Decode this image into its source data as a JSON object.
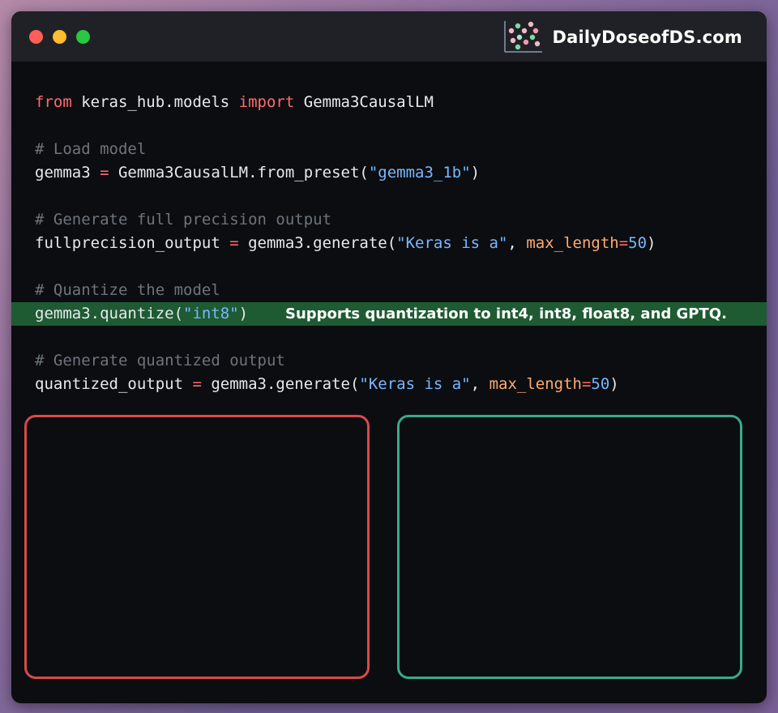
{
  "window": {
    "controls": [
      "close",
      "minimize",
      "maximize"
    ],
    "brand": "DailyDoseofDS.com"
  },
  "code": {
    "line1": {
      "kw1": "from",
      "mod": " keras_hub.models ",
      "kw2": "import",
      "cls": " Gemma3CausalLM"
    },
    "comment_load": "# Load model",
    "line_load": {
      "pre": "gemma3 ",
      "op": "=",
      "mid": " Gemma3CausalLM.from_preset(",
      "str": "\"gemma3_1b\"",
      "post": ")"
    },
    "comment_full": "# Generate full precision output",
    "line_full": {
      "pre": "fullprecision_output ",
      "op": "=",
      "mid": " gemma3.generate(",
      "str": "\"Keras is a\"",
      "sep": ", ",
      "param": "max_length",
      "eq": "=",
      "num": "50",
      "post": ")"
    },
    "comment_quant": "# Quantize the model",
    "line_quant": {
      "pre": "gemma3.quantize(",
      "str": "\"int8\"",
      "post": ")"
    },
    "note": "Supports quantization to int4, int8, float8, and GPTQ.",
    "comment_gen_quant": "# Generate quantized output",
    "line_gen_quant": {
      "pre": "quantized_output ",
      "op": "=",
      "mid": " gemma3.generate(",
      "str": "\"Keras is a\"",
      "sep": ", ",
      "param": "max_length",
      "eq": "=",
      "num": "50",
      "post": ")"
    }
  },
  "colors": {
    "keyword": "#ff6b6b",
    "string": "#79b8ff",
    "comment": "#6d747c",
    "param": "#ffab70",
    "highlight": "#1e5a32",
    "left_panel_border": "#d94a4a",
    "right_panel_border": "#3aa98c"
  }
}
